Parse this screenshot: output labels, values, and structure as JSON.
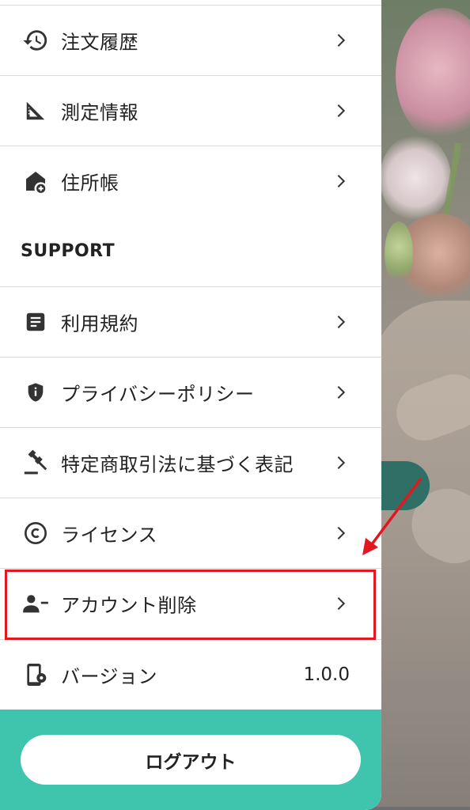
{
  "account_menu": {
    "items": [
      {
        "label": "注文履歴",
        "icon": "history-icon"
      },
      {
        "label": "測定情報",
        "icon": "ruler-triangle-icon"
      },
      {
        "label": "住所帳",
        "icon": "home-add-icon"
      }
    ]
  },
  "support": {
    "heading": "SUPPORT",
    "items": [
      {
        "label": "利用規約",
        "icon": "document-icon"
      },
      {
        "label": "プライバシーポリシー",
        "icon": "shield-icon"
      },
      {
        "label": "特定商取引法に基づく表記",
        "icon": "gavel-icon"
      },
      {
        "label": "ライセンス",
        "icon": "copyright-icon"
      },
      {
        "label": "アカウント削除",
        "icon": "person-remove-icon"
      }
    ]
  },
  "version": {
    "label": "バージョン",
    "value": "1.0.0",
    "icon": "phone-settings-icon"
  },
  "logout": {
    "label": "ログアウト"
  },
  "colors": {
    "accent": "#3fc4ae",
    "annotation": "#e2171f"
  }
}
